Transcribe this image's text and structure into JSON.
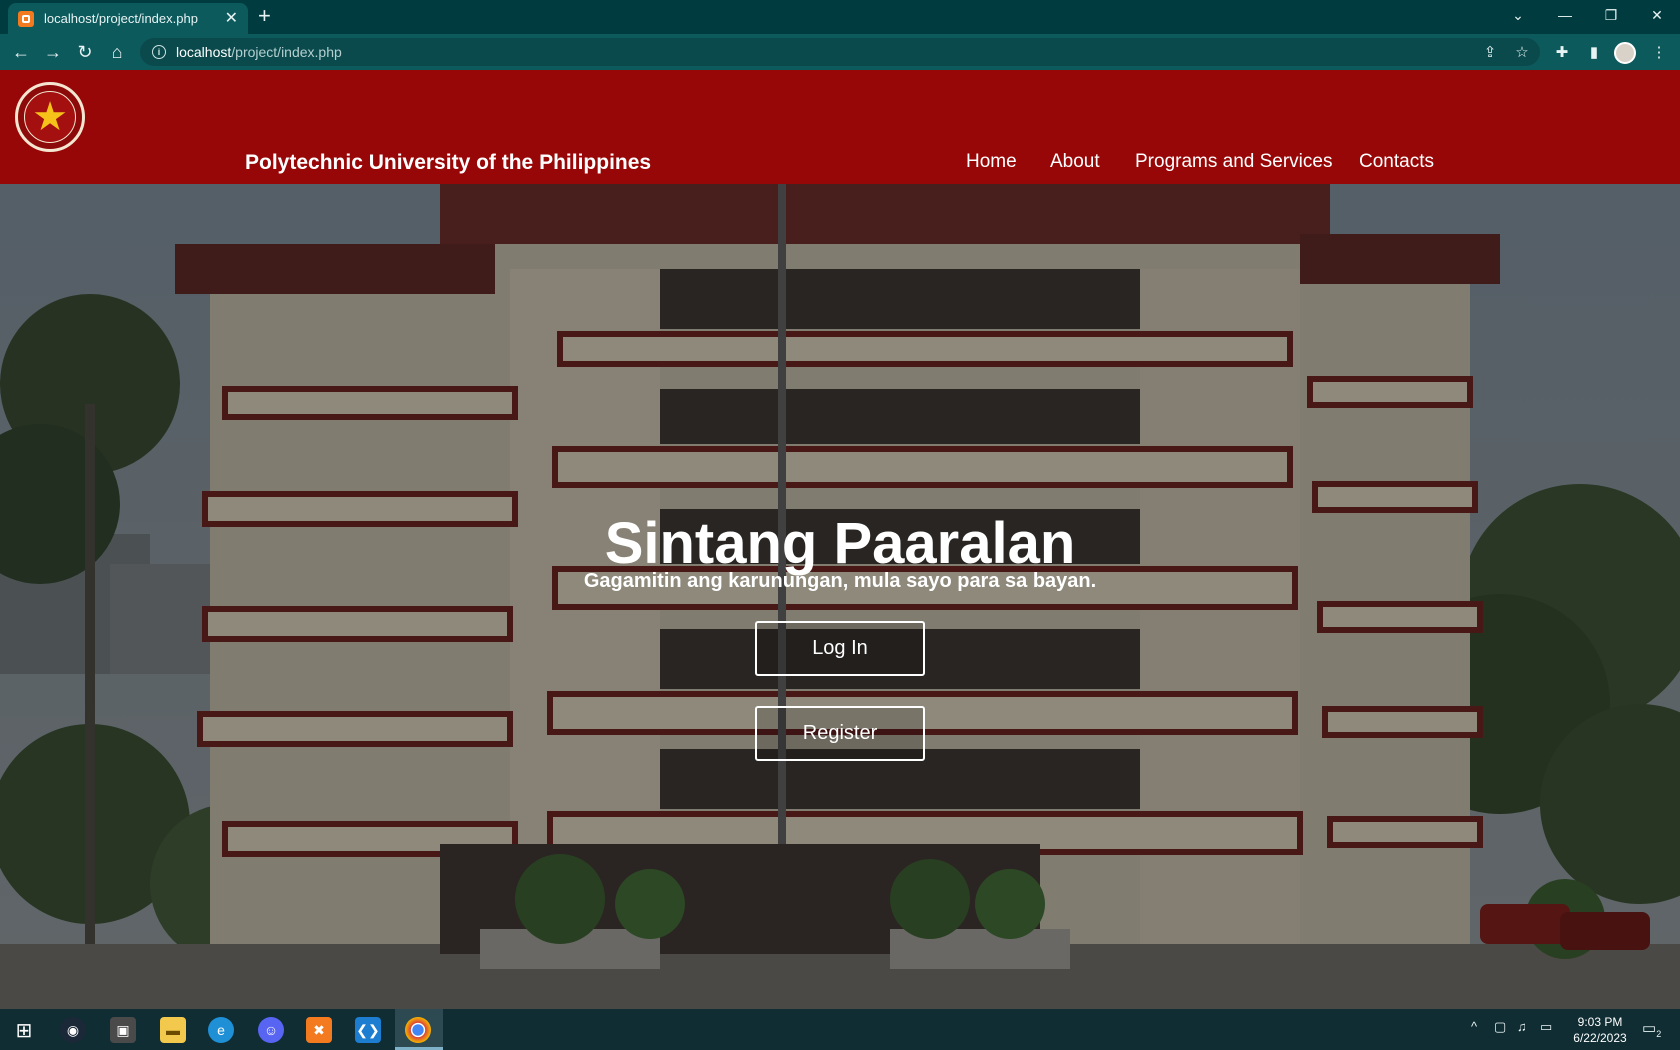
{
  "browser": {
    "tab_title": "localhost/project/index.php",
    "new_tab": "+",
    "url_host": "localhost",
    "url_path": "/project/index.php"
  },
  "site": {
    "title": "Polytechnic University of the Philippines",
    "nav": [
      "Home",
      "About",
      "Programs and Services",
      "Contacts"
    ]
  },
  "hero": {
    "title": "Sintang Paaralan",
    "subtitle": "Gagamitin ang karunungan, mula sayo para sa bayan.",
    "login_label": "Log In",
    "register_label": "Register"
  },
  "taskbar": {
    "time": "9:03 PM",
    "date": "6/22/2023",
    "notification_count": "2"
  },
  "colors": {
    "header_red": "#980707",
    "chrome_teal": "#0d5a5d"
  }
}
